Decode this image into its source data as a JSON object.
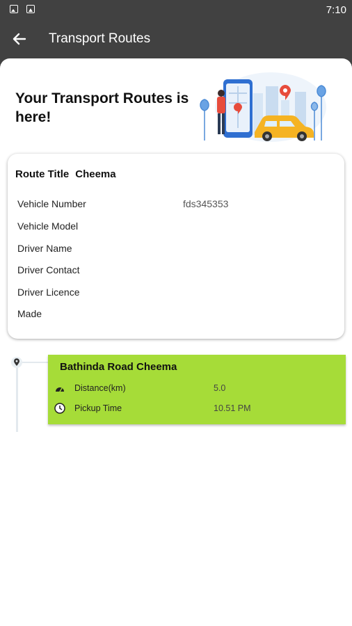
{
  "status_bar": {
    "time": "7:10"
  },
  "app_bar": {
    "title": "Transport Routes"
  },
  "hero": {
    "title": "Your Transport Routes is here!"
  },
  "route_card": {
    "route_title_label": "Route Title",
    "route_title_value": "Cheema",
    "rows": [
      {
        "label": "Vehicle Number",
        "value": "fds345353"
      },
      {
        "label": "Vehicle Model",
        "value": ""
      },
      {
        "label": "Driver Name",
        "value": ""
      },
      {
        "label": "Driver Contact",
        "value": ""
      },
      {
        "label": "Driver Licence",
        "value": ""
      },
      {
        "label": "Made",
        "value": ""
      }
    ]
  },
  "stops": [
    {
      "name": "Bathinda Road Cheema",
      "distance_label": "Distance(km)",
      "distance_value": "5.0",
      "pickup_label": "Pickup Time",
      "pickup_value": "10.51 PM"
    }
  ],
  "colors": {
    "app_bar": "#414141",
    "stop_card": "#a6dc38",
    "sheet": "#ffffff"
  },
  "icons": [
    "image-icon",
    "notification-icon",
    "back-arrow-icon",
    "location-pin-icon",
    "speedometer-icon",
    "clock-icon"
  ]
}
